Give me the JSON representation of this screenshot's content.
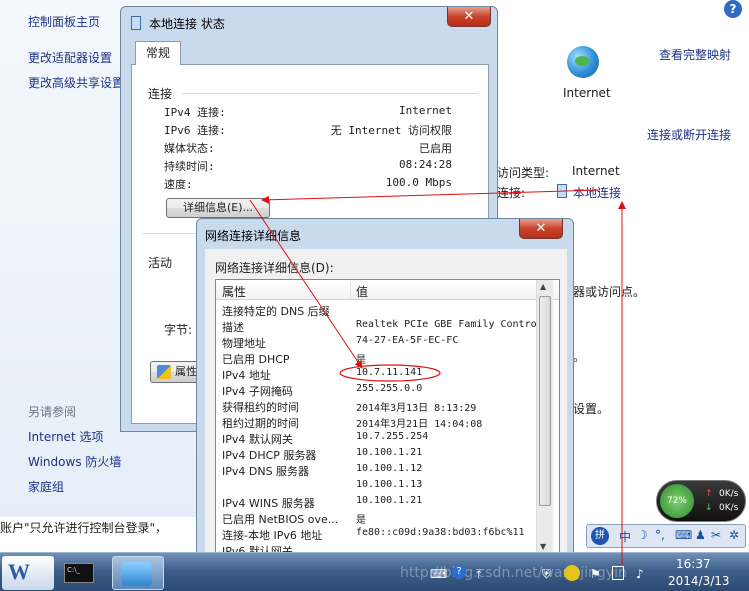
{
  "control_panel": {
    "sidebar": {
      "home": "控制面板主页",
      "change_adapter": "更改适配器设置",
      "advanced_sharing": "更改高级共享设置",
      "see_also": "另请参阅",
      "links": [
        "Internet 选项",
        "Windows 防火墙",
        "家庭组"
      ]
    },
    "view_full_map": "查看完整映射",
    "internet_label": "Internet",
    "connect_disconnect": "连接或断开连接",
    "access_type_label": "访问类型:",
    "access_type_value": "Internet",
    "connection_label": "连接:",
    "connection_value": "本地连接",
    "partial_text_1": "器或访问点。",
    "partial_text_2": "设置。",
    "behind_text": "账户\"只允许进行控制台登录\"，"
  },
  "status_window": {
    "title": "本地连接 状态",
    "tab": "常规",
    "connection_group": "连接",
    "rows": [
      {
        "label": "IPv4 连接:",
        "value": "Internet"
      },
      {
        "label": "IPv6 连接:",
        "value": "无 Internet 访问权限"
      },
      {
        "label": "媒体状态:",
        "value": "已启用"
      },
      {
        "label": "持续时间:",
        "value": "08:24:28"
      },
      {
        "label": "速度:",
        "value": "100.0 Mbps"
      }
    ],
    "details_button": "详细信息(E)...",
    "activity_group": "活动",
    "bytes_label": "字节:",
    "properties_button": "属性"
  },
  "details_window": {
    "title": "网络连接详细信息",
    "list_label": "网络连接详细信息(D):",
    "col_property": "属性",
    "col_value": "值",
    "rows": [
      {
        "p": "连接特定的 DNS 后缀",
        "v": ""
      },
      {
        "p": "描述",
        "v": "Realtek PCIe GBE Family Controller"
      },
      {
        "p": "物理地址",
        "v": "74-27-EA-5F-EC-FC"
      },
      {
        "p": "已启用 DHCP",
        "v": "是"
      },
      {
        "p": "IPv4 地址",
        "v": "10.7.11.141"
      },
      {
        "p": "IPv4 子网掩码",
        "v": "255.255.0.0"
      },
      {
        "p": "获得租约的时间",
        "v": "2014年3月13日 8:13:29"
      },
      {
        "p": "租约过期的时间",
        "v": "2014年3月21日 14:04:08"
      },
      {
        "p": "IPv4 默认网关",
        "v": "10.7.255.254"
      },
      {
        "p": "IPv4 DHCP 服务器",
        "v": "10.100.1.21"
      },
      {
        "p": "IPv4 DNS 服务器",
        "v": "10.100.1.12"
      },
      {
        "p": "",
        "v": "10.100.1.13"
      },
      {
        "p": "IPv4 WINS 服务器",
        "v": "10.100.1.21"
      },
      {
        "p": "已启用 NetBIOS ove...",
        "v": "是"
      },
      {
        "p": "连接-本地 IPv6 地址",
        "v": "fe80::c09d:9a38:bd03:f6bc%11"
      },
      {
        "p": "IPv6 默认网关",
        "v": ""
      }
    ]
  },
  "gadget": {
    "percent": "72%",
    "upload": "0K/s",
    "download": "0K/s"
  },
  "ime": {
    "label": "中"
  },
  "taskbar": {
    "time": "16:37",
    "date": "2014/3/13",
    "watermark": "http://blog.csdn.net/wangjingyin"
  },
  "colors": {
    "annotation": "#e01010",
    "link": "#1e3287",
    "title_bar": "#c9daed"
  }
}
